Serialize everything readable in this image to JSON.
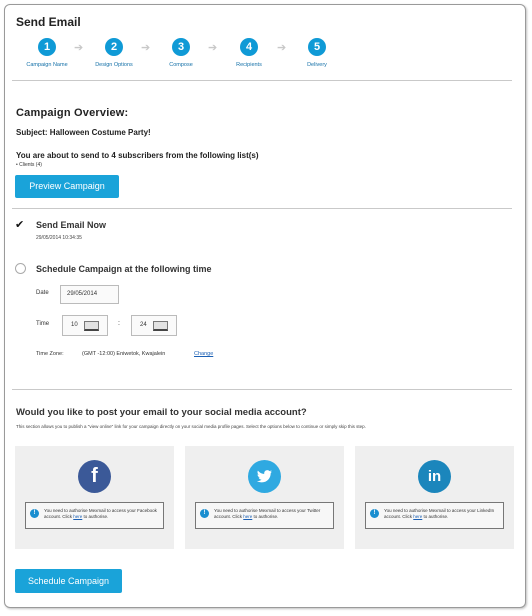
{
  "window": {
    "title": "Send Email"
  },
  "steps": [
    {
      "number": "1",
      "label": "Campaign Name"
    },
    {
      "number": "2",
      "label": "Design Options"
    },
    {
      "number": "3",
      "label": "Compose"
    },
    {
      "number": "4",
      "label": "Recipients"
    },
    {
      "number": "5",
      "label": "Delivery"
    }
  ],
  "overview": {
    "heading": "Campaign Overview:",
    "subject_label": "Subject:",
    "subject_value": "Halloween Costume Party!",
    "subscribers_text": "You are about to send to 4 subscribers from the following list(s)",
    "list_item": "• Clients (4)",
    "preview_button": "Preview Campaign"
  },
  "delivery": {
    "send_now_label": "Send Email Now",
    "send_now_checked": true,
    "send_now_date": "29/05/2014 10:34:35",
    "schedule_label": "Schedule Campaign at the following time",
    "schedule_selected": false,
    "date_label": "Date",
    "date_value": "29/05/2014",
    "time_label": "Time",
    "hour_value": "10",
    "minute_value": "24",
    "time_separator": ":",
    "timezone_label": "Time Zone:",
    "timezone_value": "(GMT -12:00) Eniwetok, Kwajalein",
    "timezone_change": "Change"
  },
  "social": {
    "heading": "Would you like to post your email to your social media account?",
    "description": "This section allows you to publish a \"view online\" link for your campaign directly on your social media profile pages. Select the options below to continue or simply skip this step.",
    "panels": [
      {
        "name": "facebook",
        "glyph": "f",
        "color": "#3b5998",
        "notice_before": "You need to authorise Mexmail to access your Facebook account. Click ",
        "notice_link": "here",
        "notice_after": " to authorise."
      },
      {
        "name": "twitter",
        "glyph": "t",
        "color": "#2fa9e1",
        "notice_before": "You need to authorise Mexmail to access your Twitter account. Click ",
        "notice_link": "here",
        "notice_after": " to authorise."
      },
      {
        "name": "linkedin",
        "glyph": "in",
        "color": "#1b86bc",
        "notice_before": "You need to authorise Mexmail to access your LinkedIn account. Click ",
        "notice_link": "here",
        "notice_after": " to authorise."
      }
    ]
  },
  "footer": {
    "schedule_button": "Schedule Campaign"
  },
  "colors": {
    "accent": "#1aa3d9",
    "step": "#0f9ad6",
    "link": "#1a5fb4",
    "panel_bg": "#efefef"
  }
}
